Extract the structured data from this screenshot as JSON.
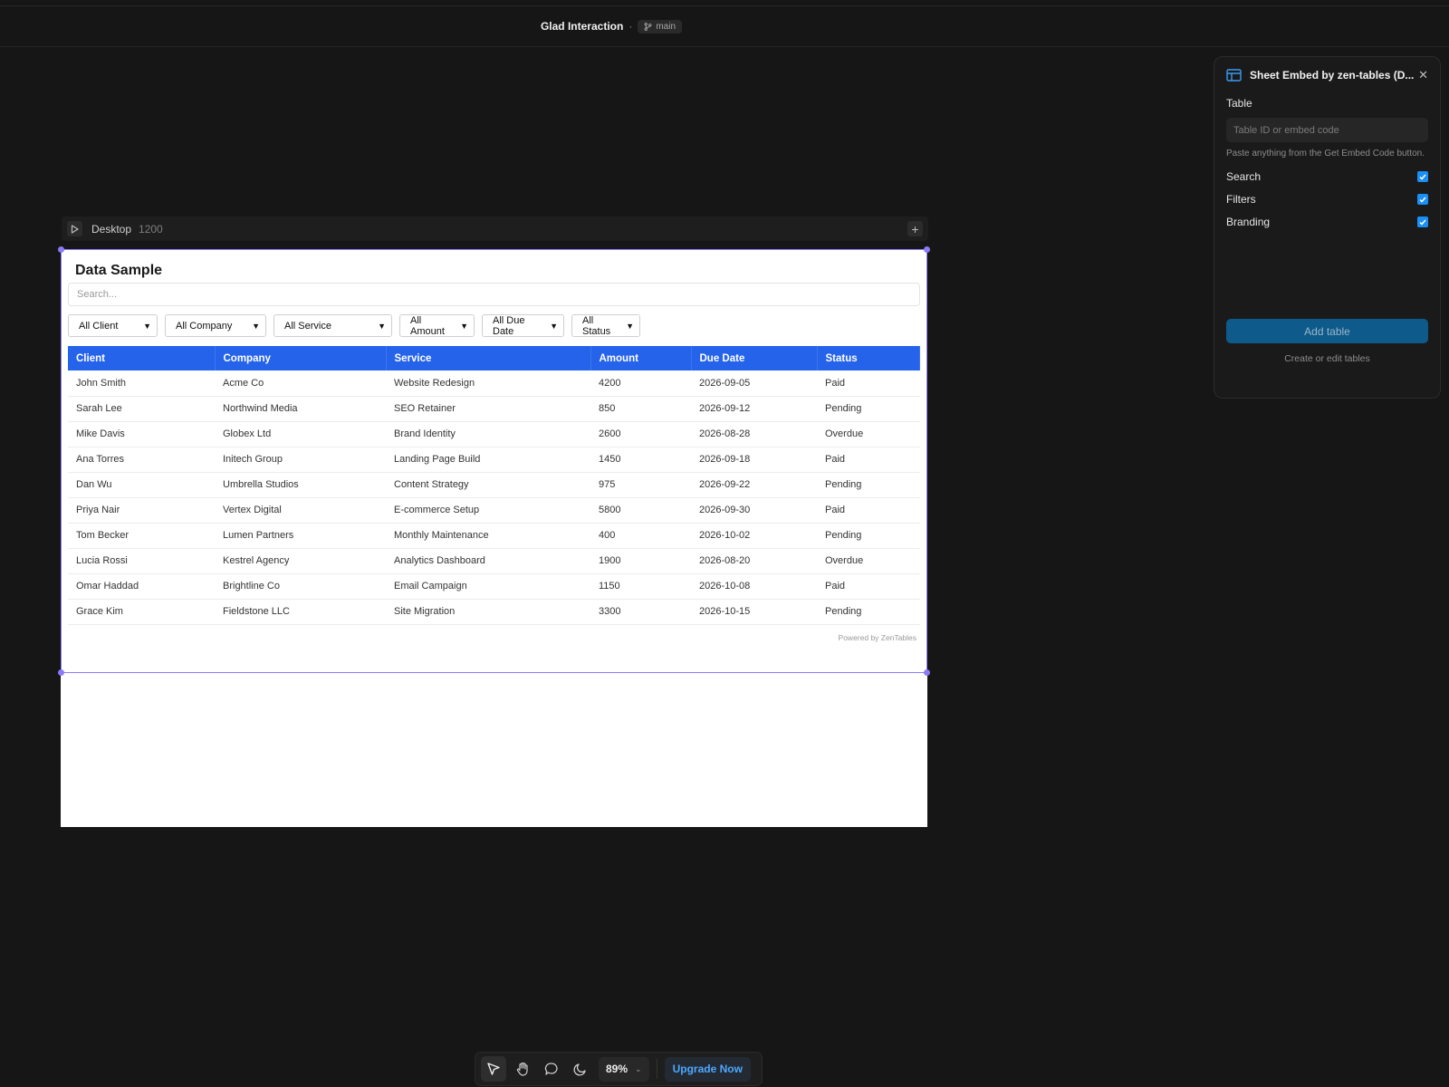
{
  "topbar": {
    "project": "Glad Interaction",
    "separator": "·",
    "branch": "main"
  },
  "frame": {
    "name": "Desktop",
    "width_label": "1200"
  },
  "embed": {
    "title": "Data Sample",
    "search_placeholder": "Search...",
    "filters": [
      "All Client",
      "All Company",
      "All Service",
      "All Amount",
      "All Due Date",
      "All Status"
    ],
    "columns": [
      "Client",
      "Company",
      "Service",
      "Amount",
      "Due Date",
      "Status"
    ],
    "rows": [
      [
        "John Smith",
        "Acme Co",
        "Website Redesign",
        "4200",
        "2026-09-05",
        "Paid"
      ],
      [
        "Sarah Lee",
        "Northwind Media",
        "SEO Retainer",
        "850",
        "2026-09-12",
        "Pending"
      ],
      [
        "Mike Davis",
        "Globex Ltd",
        "Brand Identity",
        "2600",
        "2026-08-28",
        "Overdue"
      ],
      [
        "Ana Torres",
        "Initech Group",
        "Landing Page Build",
        "1450",
        "2026-09-18",
        "Paid"
      ],
      [
        "Dan Wu",
        "Umbrella Studios",
        "Content Strategy",
        "975",
        "2026-09-22",
        "Pending"
      ],
      [
        "Priya Nair",
        "Vertex Digital",
        "E-commerce Setup",
        "5800",
        "2026-09-30",
        "Paid"
      ],
      [
        "Tom Becker",
        "Lumen Partners",
        "Monthly Maintenance",
        "400",
        "2026-10-02",
        "Pending"
      ],
      [
        "Lucia Rossi",
        "Kestrel Agency",
        "Analytics Dashboard",
        "1900",
        "2026-08-20",
        "Overdue"
      ],
      [
        "Omar Haddad",
        "Brightline Co",
        "Email Campaign",
        "1150",
        "2026-10-08",
        "Paid"
      ],
      [
        "Grace Kim",
        "Fieldstone LLC",
        "Site Migration",
        "3300",
        "2026-10-15",
        "Pending"
      ]
    ],
    "powered_by": "Powered by ZenTables",
    "header_color": "#2563eb"
  },
  "panel": {
    "title": "Sheet Embed by zen-tables (D...",
    "table_label": "Table",
    "table_placeholder": "Table ID or embed code",
    "hint": "Paste anything from the Get Embed Code button.",
    "options": [
      {
        "label": "Search",
        "checked": true
      },
      {
        "label": "Filters",
        "checked": true
      },
      {
        "label": "Branding",
        "checked": true
      }
    ],
    "add_button": "Add table",
    "create_link": "Create or edit tables"
  },
  "toolbar": {
    "tools": [
      "pointer-icon",
      "hand-icon",
      "comment-icon",
      "moon-icon"
    ],
    "zoom": "89%",
    "upgrade": "Upgrade Now"
  },
  "colors": {
    "accent": "#8b7cf6",
    "checkbox": "#1a8ff5",
    "upgrade": "#4ea8ff"
  }
}
